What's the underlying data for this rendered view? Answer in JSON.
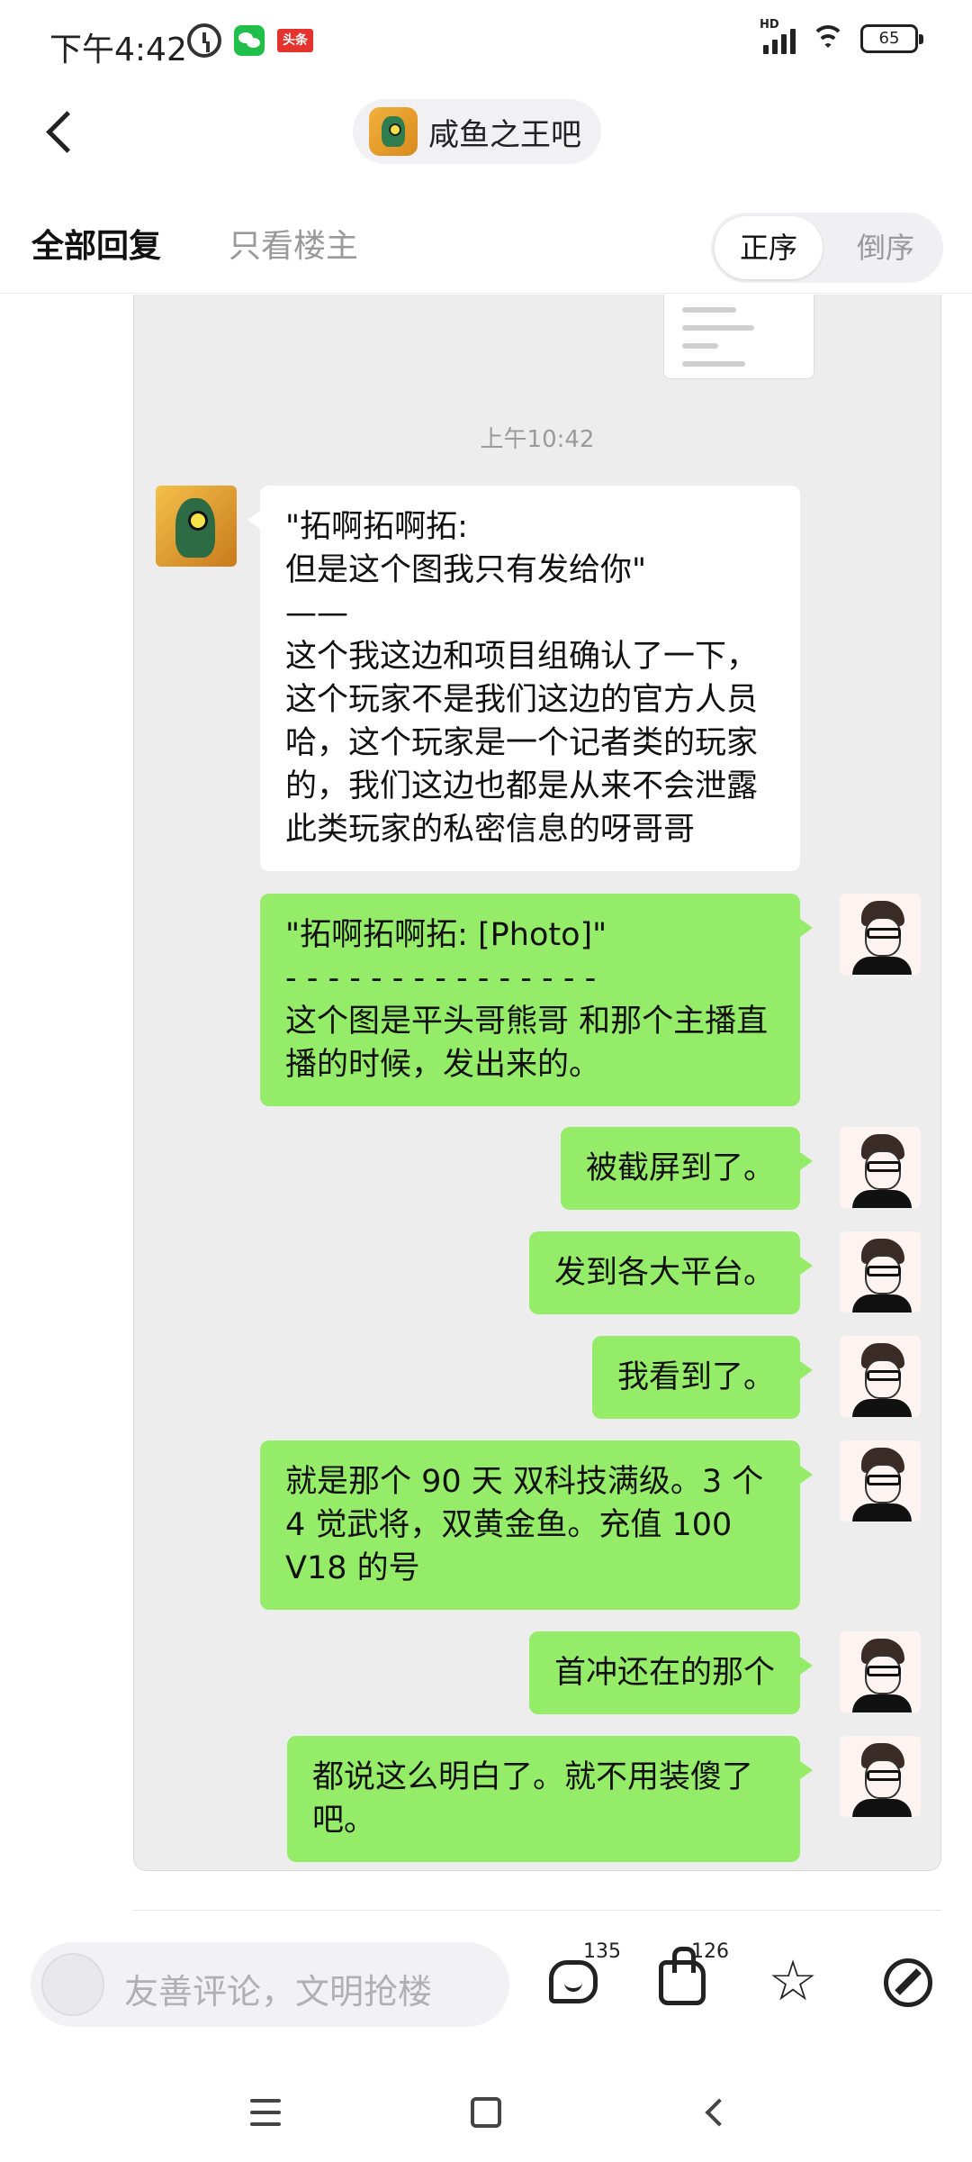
{
  "status_bar": {
    "time": "下午4:42",
    "network": "HD",
    "battery": "65",
    "icons": [
      "alarm-icon",
      "wechat-icon",
      "toutiao-icon",
      "signal-icon",
      "wifi-icon",
      "battery-icon"
    ],
    "toutiao_label": "头条"
  },
  "header": {
    "forum_name": "咸鱼之王吧"
  },
  "tabs": {
    "all_replies": "全部回复",
    "owner_only": "只看楼主",
    "order_asc": "正序",
    "order_desc": "倒序"
  },
  "chat": {
    "timestamp": "上午10:42",
    "messages": [
      {
        "side": "left",
        "text": "\"拓啊拓啊拓:\n但是这个图我只有发给你\"\n——\n这个我这边和项目组确认了一下，这个玩家不是我们这边的官方人员哈，这个玩家是一个记者类的玩家的，我们这边也都是从来不会泄露此类玩家的私密信息的呀哥哥"
      },
      {
        "side": "right",
        "text": "\"拓啊拓啊拓: [Photo]\"\n- - - - - - - - - - - - - - -\n这个图是平头哥熊哥 和那个主播直播的时候，发出来的。"
      },
      {
        "side": "right",
        "text": "被截屏到了。"
      },
      {
        "side": "right",
        "text": "发到各大平台。"
      },
      {
        "side": "right",
        "text": "我看到了。"
      },
      {
        "side": "right",
        "text": "就是那个 90 天 双科技满级。3 个 4 觉武将，双黄金鱼。充值 100 V18 的号"
      },
      {
        "side": "right",
        "text": "首冲还在的那个"
      },
      {
        "side": "right",
        "text": "都说这么明白了。就不用装傻了吧。"
      }
    ]
  },
  "action_bar": {
    "comment_placeholder": "友善评论，文明抢楼",
    "comment_count": "135",
    "like_count": "126"
  },
  "colors": {
    "green_bubble": "#95ec69",
    "white_bubble": "#ffffff",
    "chat_background": "#ededed"
  }
}
